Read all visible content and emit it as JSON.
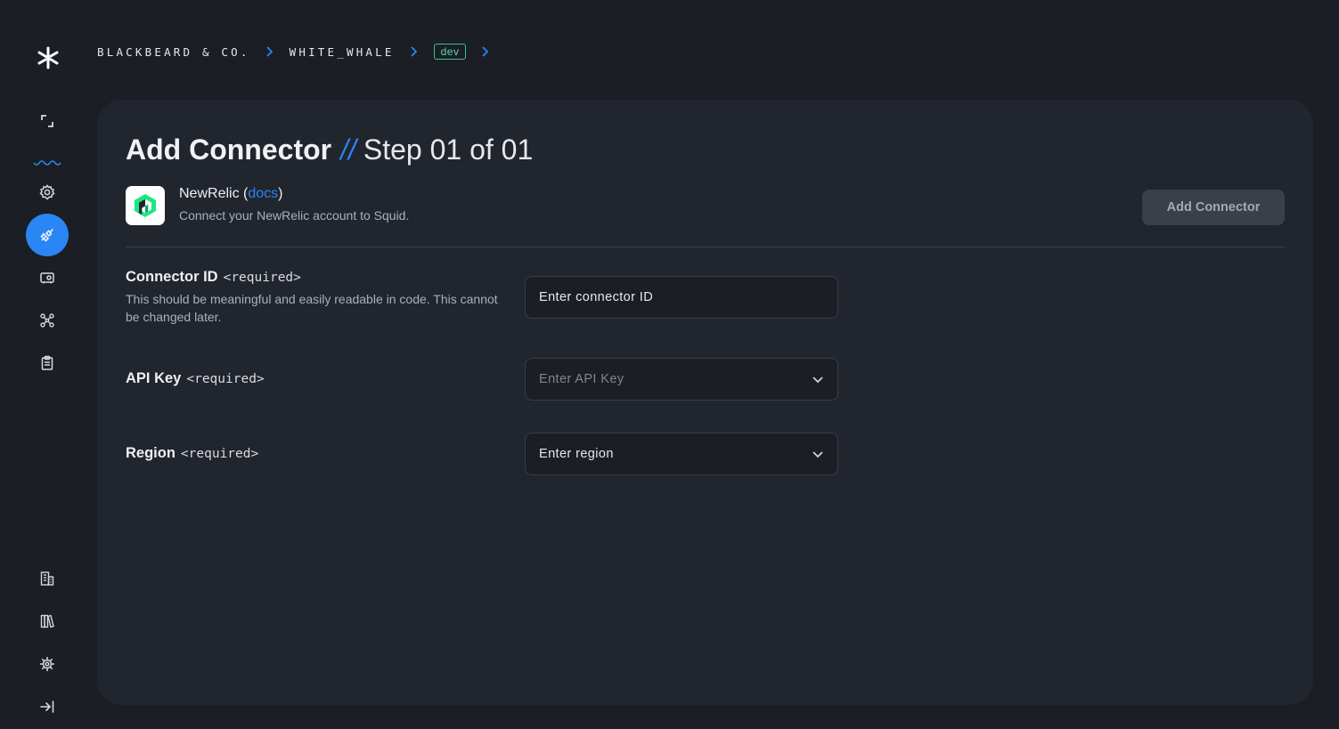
{
  "breadcrumb": {
    "org": "BLACKBEARD & CO.",
    "app": "WHITE_WHALE",
    "env": "dev"
  },
  "sidebar": {
    "items": [
      {
        "icon": "expand-icon"
      },
      {
        "icon": "settings-icon"
      },
      {
        "icon": "connectors-icon",
        "active": true
      },
      {
        "icon": "secrets-icon"
      },
      {
        "icon": "graph-icon"
      },
      {
        "icon": "clipboard-icon"
      },
      {
        "icon": "organization-icon"
      },
      {
        "icon": "docs-icon"
      },
      {
        "icon": "gear-icon"
      },
      {
        "icon": "collapse-icon"
      }
    ],
    "accent": "#2a85f5"
  },
  "page": {
    "title": "Add Connector",
    "separator": "//",
    "step": "Step 01 of 01"
  },
  "connector": {
    "name": "NewRelic",
    "docs_label": "docs",
    "description": "Connect your NewRelic account to Squid.",
    "add_button": "Add Connector"
  },
  "form": {
    "connector_id": {
      "label": "Connector ID",
      "required": "<required>",
      "help": "This should be meaningful and easily readable in code. This cannot be changed later.",
      "placeholder": "Enter connector ID"
    },
    "api_key": {
      "label": "API Key",
      "required": "<required>",
      "placeholder": "Enter API Key"
    },
    "region": {
      "label": "Region",
      "required": "<required>",
      "placeholder": "Enter region"
    }
  }
}
